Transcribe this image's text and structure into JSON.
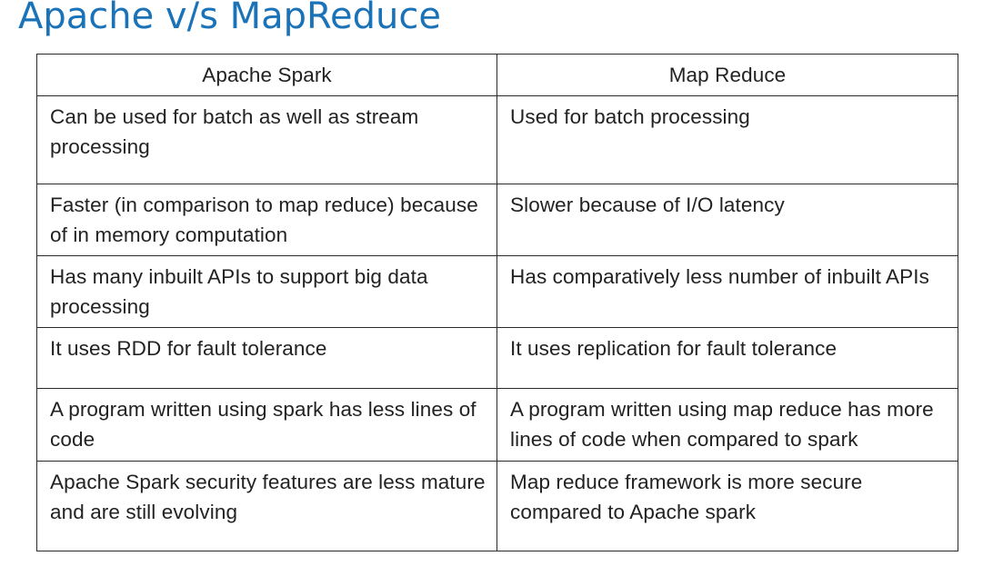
{
  "title": "Apache v/s MapReduce",
  "table": {
    "headers": [
      "Apache Spark",
      "Map Reduce"
    ],
    "rows": [
      [
        "Can be used for batch as well as stream processing",
        "Used for batch processing"
      ],
      [
        "Faster (in comparison to map reduce) because of in memory computation",
        "Slower because of I/O latency"
      ],
      [
        "Has many inbuilt APIs to support big data processing",
        "Has comparatively less number of inbuilt APIs"
      ],
      [
        "It uses RDD for fault tolerance",
        "It uses replication for fault tolerance"
      ],
      [
        "A program written using spark has less lines of code",
        "A program written using map reduce has more lines of code when compared to spark"
      ],
      [
        "Apache Spark security features are less mature and are still evolving",
        "Map reduce framework is more secure compared to Apache spark"
      ]
    ]
  },
  "colors": {
    "title": "#1a73b8",
    "text": "#222222",
    "border": "#2a2a2a"
  }
}
